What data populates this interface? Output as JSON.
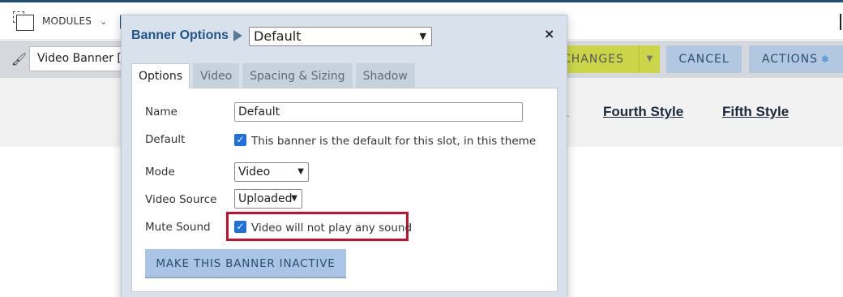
{
  "toolbar": {
    "modules_label": "MODULES",
    "modules_chevron": "⌄"
  },
  "toolbar2": {
    "banner_select_value": "Video Banner [inc",
    "save_label": "CHANGES",
    "save_dropdown": "▼",
    "cancel_label": "CANCEL",
    "actions_label": "ACTIONS",
    "actions_icon": "❄"
  },
  "nav": {
    "fourth": "Fourth Style",
    "fifth": "Fifth Style"
  },
  "modal": {
    "title": "Banner Options",
    "style_value": "Default",
    "close": "×",
    "tabs": [
      {
        "label": "Options"
      },
      {
        "label": "Video"
      },
      {
        "label": "Spacing & Sizing"
      },
      {
        "label": "Shadow"
      }
    ],
    "fields": {
      "name_label": "Name",
      "name_value": "Default",
      "default_label": "Default",
      "default_text": "This banner is the default for this slot, in this theme",
      "mode_label": "Mode",
      "mode_value": "Video",
      "source_label": "Video Source",
      "source_value": "Uploaded",
      "mute_label": "Mute Sound",
      "mute_text": "Video will not play any sound"
    },
    "inactive_button": "MAKE THIS BANNER INACTIVE",
    "highlight_color": "#c8102e"
  }
}
